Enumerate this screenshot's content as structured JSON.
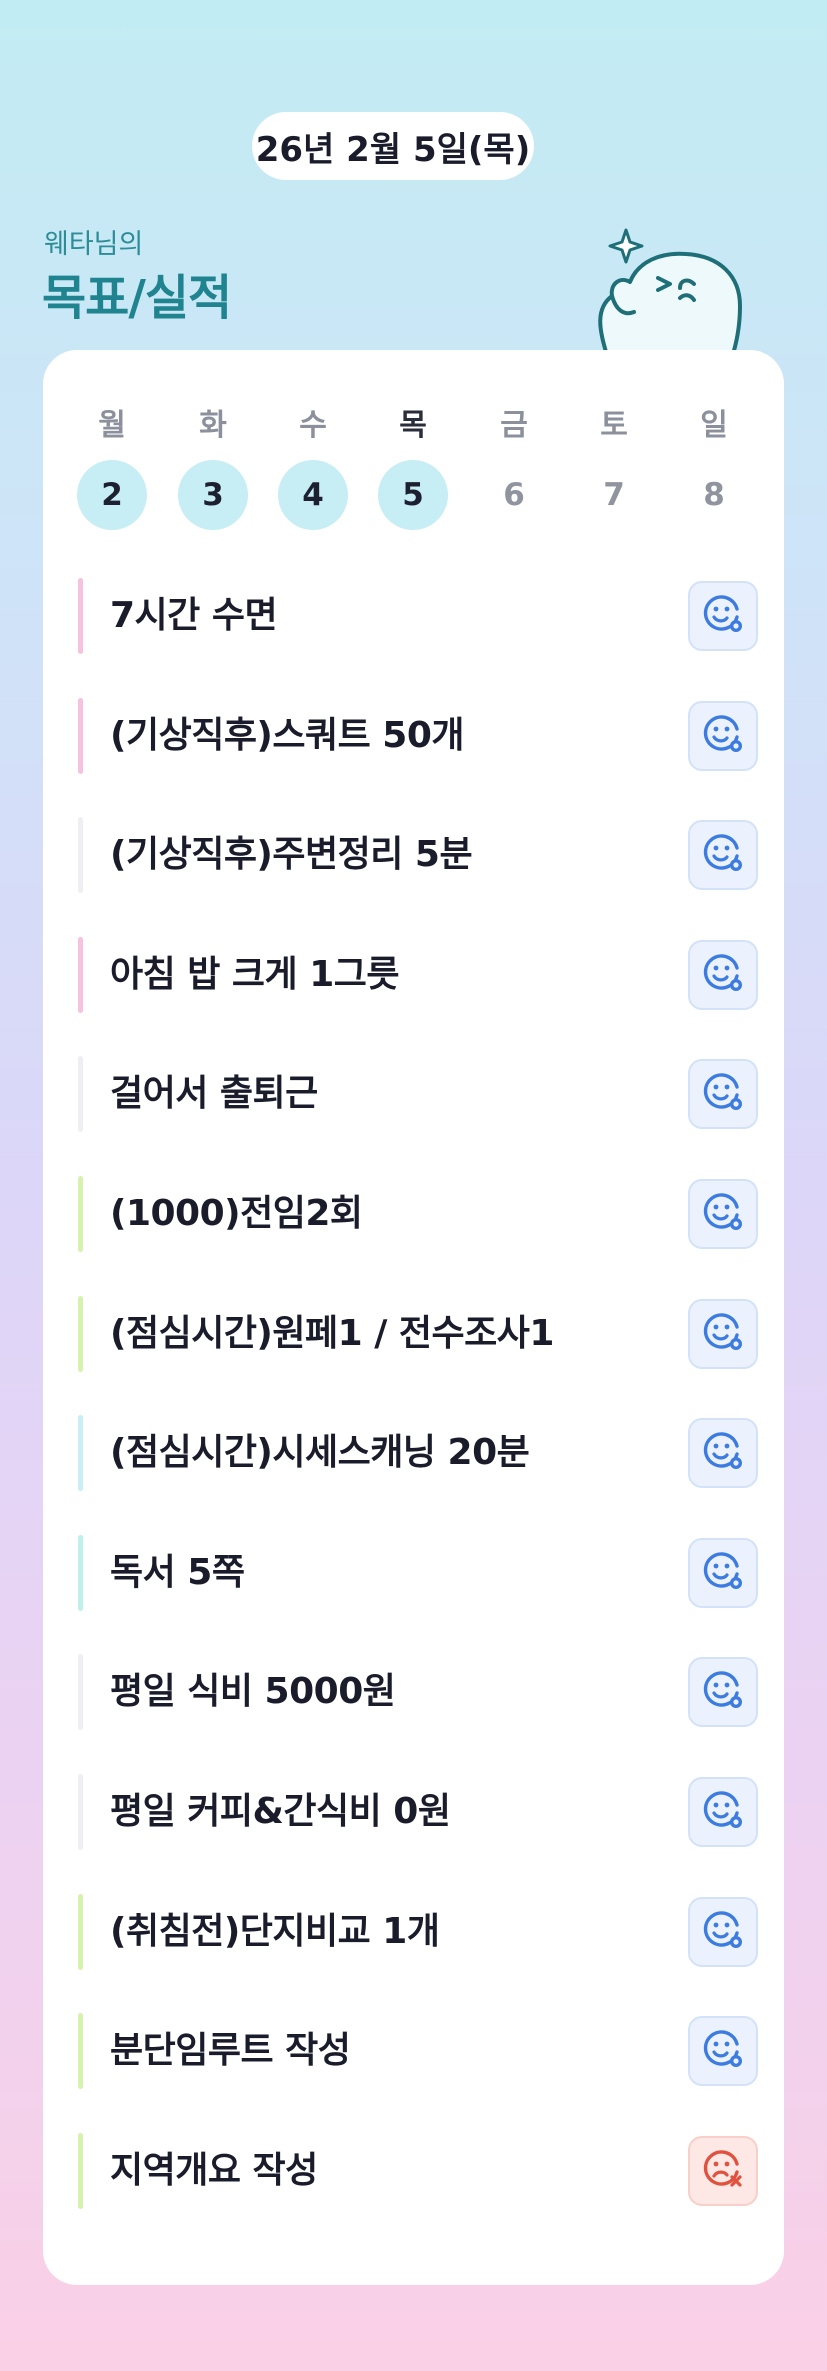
{
  "date_label": "26년 2월 5일(목)",
  "header": {
    "subtitle": "웨타님의",
    "title": "목표/실적"
  },
  "colors": {
    "accent_teal": "#1f8490",
    "day_done_bg": "#c6eef4",
    "status_ok": "#3c7be0",
    "status_fail": "#e0513e"
  },
  "week": {
    "days": [
      {
        "weekday": "월",
        "date": "2",
        "done": true,
        "active": false
      },
      {
        "weekday": "화",
        "date": "3",
        "done": true,
        "active": false
      },
      {
        "weekday": "수",
        "date": "4",
        "done": true,
        "active": false
      },
      {
        "weekday": "목",
        "date": "5",
        "done": true,
        "active": true
      },
      {
        "weekday": "금",
        "date": "6",
        "done": false,
        "active": false
      },
      {
        "weekday": "토",
        "date": "7",
        "done": false,
        "active": false
      },
      {
        "weekday": "일",
        "date": "8",
        "done": false,
        "active": false
      }
    ]
  },
  "goals": [
    {
      "label": "7시간 수면",
      "bar_color": "#f6c3de",
      "status": "success",
      "status_icon": "smile-check-icon"
    },
    {
      "label": "(기상직후)스쿼트 50개",
      "bar_color": "#f6c3de",
      "status": "success",
      "status_icon": "smile-check-icon"
    },
    {
      "label": "(기상직후)주변정리 5분",
      "bar_color": "#eeeff2",
      "status": "success",
      "status_icon": "smile-check-icon"
    },
    {
      "label": "아침 밥 크게 1그릇",
      "bar_color": "#f6c3de",
      "status": "success",
      "status_icon": "smile-check-icon"
    },
    {
      "label": "걸어서 출퇴근",
      "bar_color": "#eeeff2",
      "status": "success",
      "status_icon": "smile-check-icon"
    },
    {
      "label": "(1000)전임2회",
      "bar_color": "#d7f1ae",
      "status": "success",
      "status_icon": "smile-check-icon"
    },
    {
      "label": "(점심시간)원페1 / 전수조사1",
      "bar_color": "#d7f1ae",
      "status": "success",
      "status_icon": "smile-check-icon"
    },
    {
      "label": "(점심시간)시세스캐닝 20분",
      "bar_color": "#c9eef4",
      "status": "success",
      "status_icon": "smile-check-icon"
    },
    {
      "label": "독서 5쪽",
      "bar_color": "#bff0e9",
      "status": "success",
      "status_icon": "smile-check-icon"
    },
    {
      "label": "평일 식비 5000원",
      "bar_color": "#eeeff2",
      "status": "success",
      "status_icon": "smile-check-icon"
    },
    {
      "label": "평일 커피&간식비 0원",
      "bar_color": "#eeeff2",
      "status": "success",
      "status_icon": "smile-check-icon"
    },
    {
      "label": "(취침전)단지비교 1개",
      "bar_color": "#d7f1ae",
      "status": "success",
      "status_icon": "smile-check-icon"
    },
    {
      "label": "분단임루트 작성",
      "bar_color": "#d7f1ae",
      "status": "success",
      "status_icon": "smile-check-icon"
    },
    {
      "label": "지역개요 작성",
      "bar_color": "#d7f1ae",
      "status": "fail",
      "status_icon": "frown-x-icon"
    }
  ]
}
